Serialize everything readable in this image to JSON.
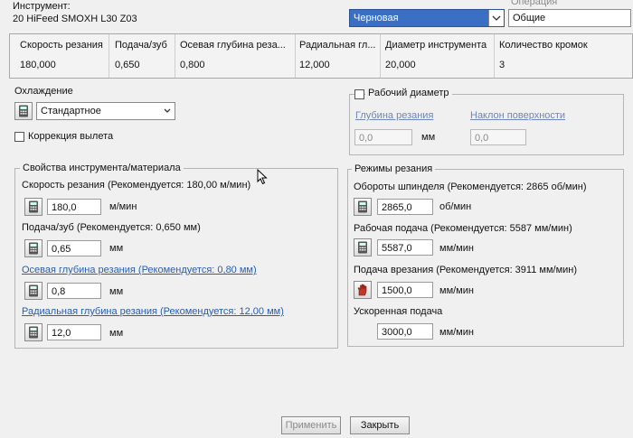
{
  "header": {
    "tool_label": "Инструмент:",
    "tool_name": "20 HiFeed SMOXH L30 Z03",
    "operation_label": "Операция",
    "mode_select": "Черновая",
    "operation_select": "Общие"
  },
  "summary_table": {
    "headers": [
      "Скорость резания",
      "Подача/зуб",
      "Осевая глубина реза...",
      "Радиальная гл...",
      "Диаметр инструмента",
      "Количество кромок"
    ],
    "values": [
      "180,000",
      "0,650",
      "0,800",
      "12,000",
      "20,000",
      "3"
    ]
  },
  "cooling": {
    "label": "Охлаждение",
    "value": "Стандартное",
    "overhang_label": "Коррекция вылета"
  },
  "working_diameter": {
    "label": "Рабочий диаметр",
    "depth_label": "Глубина резания",
    "depth_value": "0,0",
    "depth_unit": "мм",
    "slope_label": "Наклон поверхности",
    "slope_value": "0,0"
  },
  "tool_props": {
    "title": "Свойства инструмента/материала",
    "speed_label": "Скорость резания (Рекомендуется: 180,00 м/мин)",
    "speed_value": "180,0",
    "speed_unit": "м/мин",
    "feed_label": "Подача/зуб (Рекомендуется: 0,650 мм)",
    "feed_value": "0,65",
    "feed_unit": "мм",
    "axial_label": "Осевая глубина резания (Рекомендуется: 0,80 мм)",
    "axial_value": "0,8",
    "axial_unit": "мм",
    "radial_label": "Радиальная глубина резания (Рекомендуется: 12,00 мм)",
    "radial_value": "12,0",
    "radial_unit": "мм"
  },
  "cutting_modes": {
    "title": "Режимы резания",
    "spindle_label": "Обороты шпинделя (Рекомендуется: 2865 об/мин)",
    "spindle_value": "2865,0",
    "spindle_unit": "об/мин",
    "work_feed_label": "Рабочая подача (Рекомендуется: 5587 мм/мин)",
    "work_feed_value": "5587,0",
    "work_feed_unit": "мм/мин",
    "plunge_label": "Подача врезания (Рекомендуется: 3911 мм/мин)",
    "plunge_value": "1500,0",
    "plunge_unit": "мм/мин",
    "rapid_label": "Ускоренная подача",
    "rapid_value": "3000,0",
    "rapid_unit": "мм/мин"
  },
  "buttons": {
    "apply": "Применить",
    "close": "Закрыть"
  },
  "icons": {
    "calculator": "calculator-icon",
    "hand": "hand-icon",
    "dropdown": "chevron-down-icon"
  }
}
